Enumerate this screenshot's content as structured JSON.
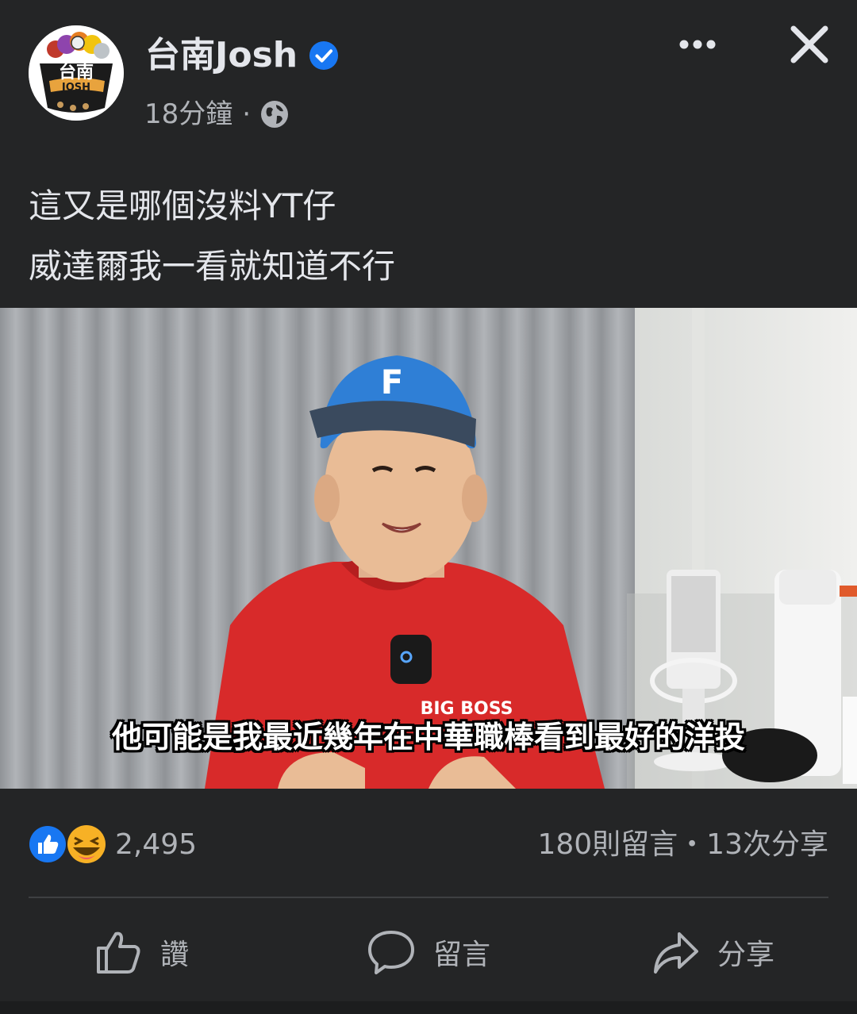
{
  "post": {
    "page_name": "台南Josh",
    "time": "18分鐘",
    "separator": "·",
    "caption_lines": [
      "這又是哪個沒料YT仔",
      "威達爾我一看就知道不行"
    ],
    "avatar_text_top": "台南",
    "avatar_text_bottom": "JOSH"
  },
  "media": {
    "subtitle": "他可能是我最近幾年在中華職棒看到最好的洋投",
    "cap_letter": "F",
    "shirt_text": "BIG BOSS"
  },
  "stats": {
    "reaction_count": "2,495",
    "comments_shares": "180則留言・13次分享"
  },
  "actions": {
    "like": "讚",
    "comment": "留言",
    "share": "分享"
  },
  "colors": {
    "background": "#242526",
    "text_primary": "#e4e6eb",
    "text_secondary": "#b0b3b8",
    "verified": "#1877f2",
    "divider": "#3e4042"
  },
  "icons": [
    "more-icon",
    "close-icon",
    "verified-icon",
    "globe-icon",
    "like-reaction-icon",
    "haha-reaction-icon",
    "thumbs-up-icon",
    "comment-icon",
    "share-icon"
  ]
}
